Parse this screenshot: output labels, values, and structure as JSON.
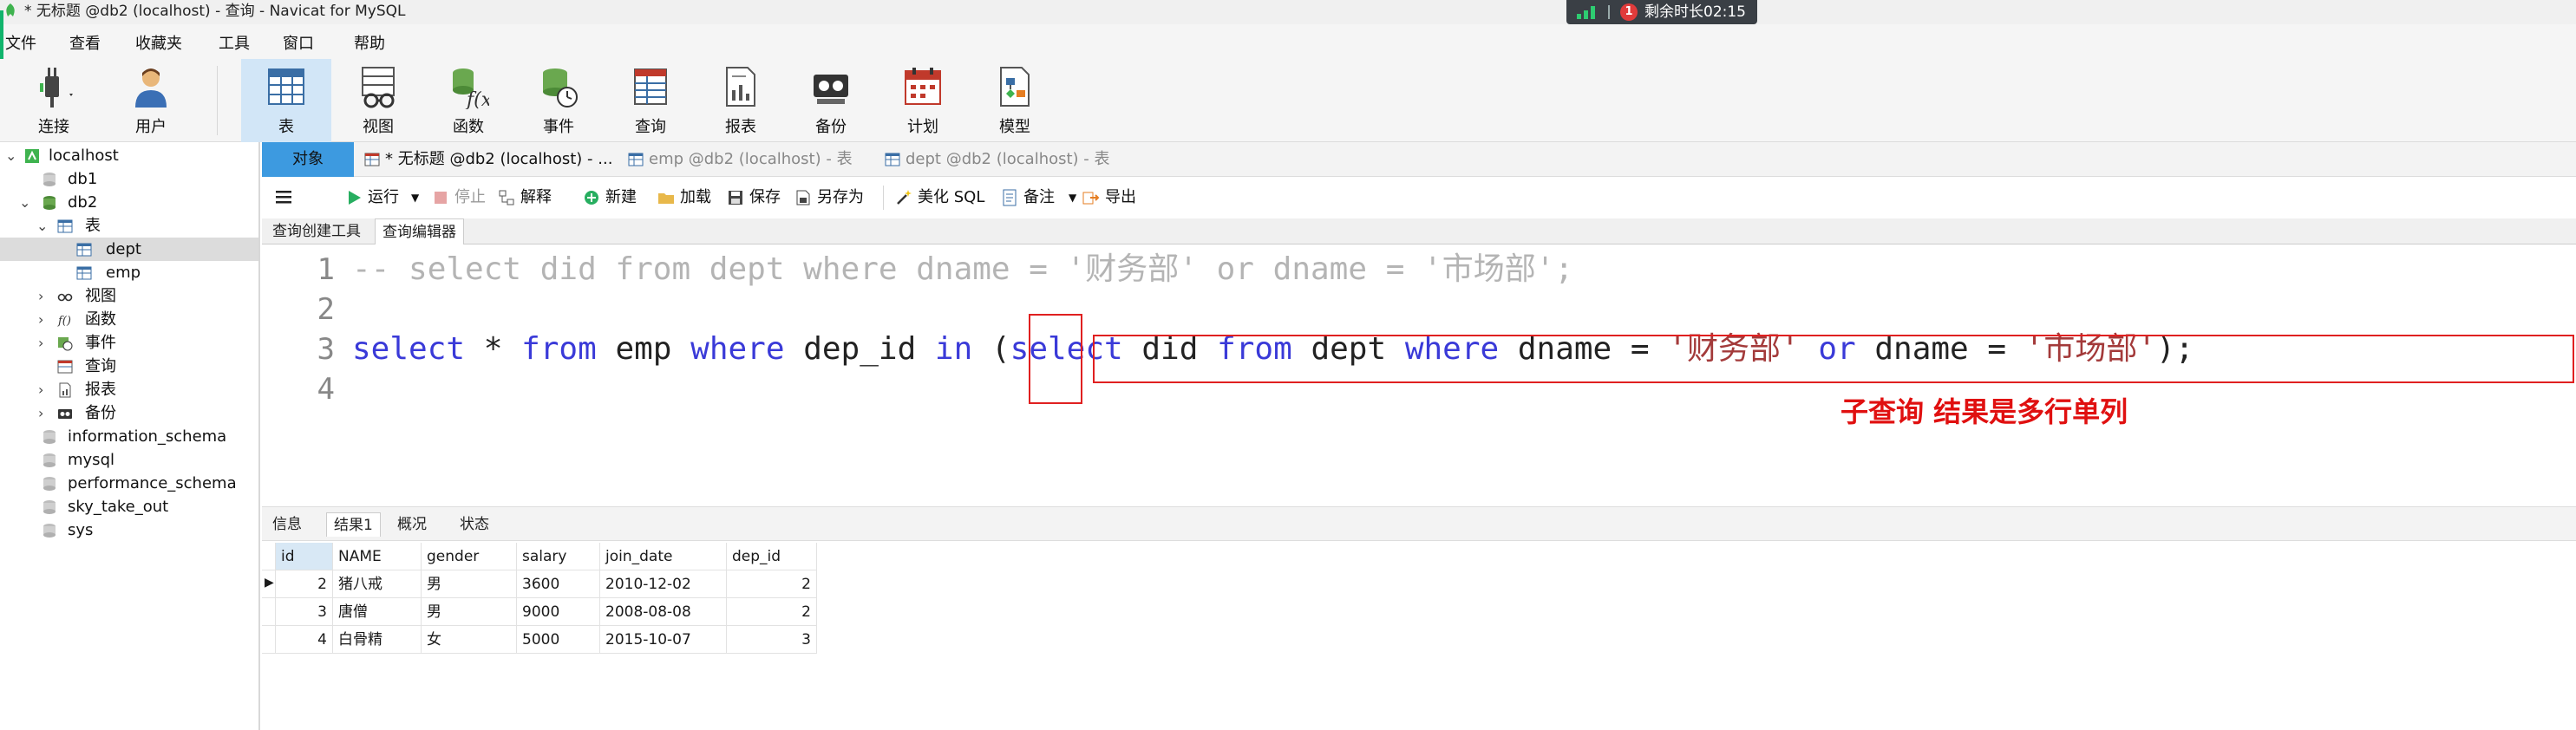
{
  "window": {
    "title": "* 无标题 @db2 (localhost) - 查询 - Navicat for MySQL"
  },
  "timer": {
    "label": "剩余时长02:15",
    "dot": "1"
  },
  "menu": [
    "文件",
    "查看",
    "收藏夹",
    "工具",
    "窗口",
    "帮助"
  ],
  "toolbar": [
    {
      "label": "连接",
      "icon": "plug-icon"
    },
    {
      "label": "用户",
      "icon": "user-icon"
    },
    {
      "label": "表",
      "icon": "table-icon"
    },
    {
      "label": "视图",
      "icon": "view-icon"
    },
    {
      "label": "函数",
      "icon": "function-icon"
    },
    {
      "label": "事件",
      "icon": "event-icon"
    },
    {
      "label": "查询",
      "icon": "query-icon"
    },
    {
      "label": "报表",
      "icon": "report-icon"
    },
    {
      "label": "备份",
      "icon": "backup-icon"
    },
    {
      "label": "计划",
      "icon": "schedule-icon"
    },
    {
      "label": "模型",
      "icon": "model-icon"
    }
  ],
  "tree": [
    {
      "label": "localhost"
    },
    {
      "label": "db1"
    },
    {
      "label": "db2"
    },
    {
      "label": "表"
    },
    {
      "label": "dept"
    },
    {
      "label": "emp"
    },
    {
      "label": "视图"
    },
    {
      "label": "函数"
    },
    {
      "label": "事件"
    },
    {
      "label": "查询"
    },
    {
      "label": "报表"
    },
    {
      "label": "备份"
    },
    {
      "label": "information_schema"
    },
    {
      "label": "mysql"
    },
    {
      "label": "performance_schema"
    },
    {
      "label": "sky_take_out"
    },
    {
      "label": "sys"
    }
  ],
  "tabs": [
    {
      "label": "对象"
    },
    {
      "label": "* 无标题 @db2 (localhost) - ..."
    },
    {
      "label": "emp @db2 (localhost) - 表"
    },
    {
      "label": "dept @db2 (localhost) - 表"
    }
  ],
  "qtool": {
    "run": "运行",
    "stop": "停止",
    "explain": "解释",
    "new": "新建",
    "load": "加载",
    "save": "保存",
    "save_as": "另存为",
    "beautify": "美化 SQL",
    "note": "备注",
    "export": "导出"
  },
  "subtabs": [
    "查询创建工具",
    "查询编辑器"
  ],
  "editor": {
    "line_numbers": [
      "1",
      "2",
      "3",
      "4"
    ],
    "line1": "-- select did from dept where dname = '财务部' or dname = '市场部';",
    "line3": {
      "t1": "select",
      "t2": " * ",
      "t3": "from",
      "t4": " emp ",
      "t5": "where",
      "t6": " dep_id ",
      "t7": "in",
      "t8": " (",
      "t9": "select",
      "t10": " did ",
      "t11": "from",
      "t12": " dept ",
      "t13": "where",
      "t14": " dname = ",
      "t15": "'财务部'",
      "t16": " ",
      "t17": "or",
      "t18": " dname = ",
      "t19": "'市场部'",
      "t20": ");"
    },
    "annotation": "子查询  结果是多行单列"
  },
  "result_tabs": [
    "信息",
    "结果1",
    "概况",
    "状态"
  ],
  "grid": {
    "columns": [
      "id",
      "NAME",
      "gender",
      "salary",
      "join_date",
      "dep_id"
    ],
    "rows": [
      [
        "2",
        "猪八戒",
        "男",
        "3600",
        "2010-12-02",
        "2"
      ],
      [
        "3",
        "唐僧",
        "男",
        "9000",
        "2008-08-08",
        "2"
      ],
      [
        "4",
        "白骨精",
        "女",
        "5000",
        "2015-10-07",
        "3"
      ]
    ]
  }
}
